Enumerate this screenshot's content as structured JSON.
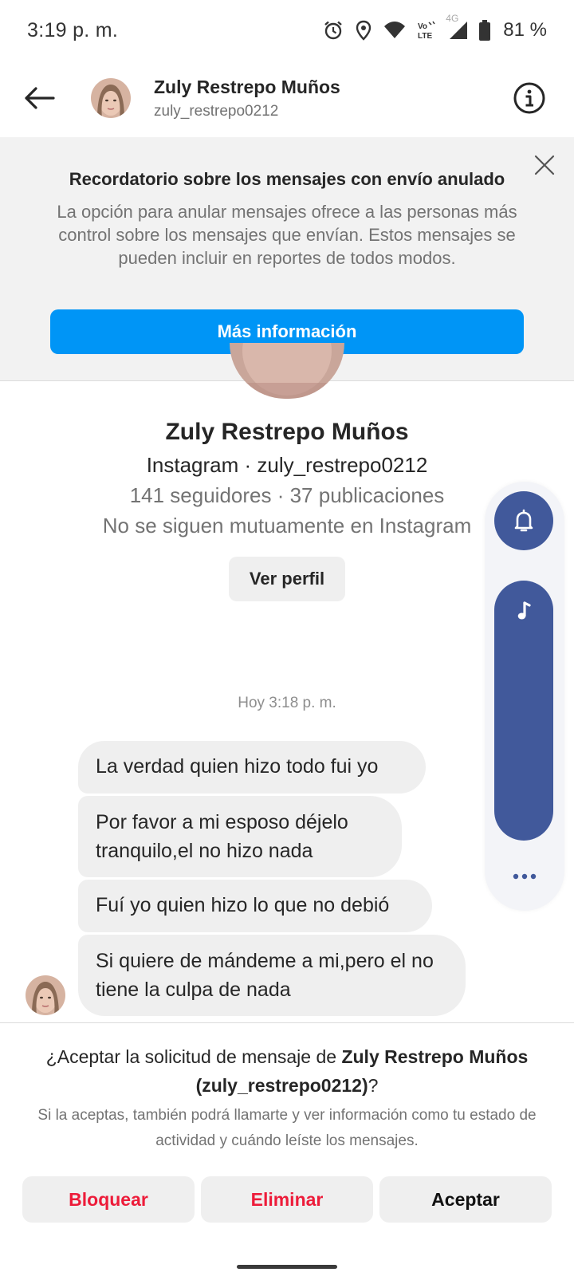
{
  "status_bar": {
    "time": "3:19 p. m.",
    "network_label": "4G",
    "battery": "81 %",
    "icons": [
      "alarm-icon",
      "location-icon",
      "wifi-icon",
      "volte-icon",
      "signal-icon",
      "battery-icon"
    ]
  },
  "header": {
    "name": "Zuly Restrepo Muños",
    "username": "zuly_restrepo0212"
  },
  "banner": {
    "title": "Recordatorio sobre los mensajes con envío anulado",
    "text": "La opción para anular mensajes ofrece a las personas más control sobre los mensajes que envían. Estos mensajes se pueden incluir en reportes de todos modos.",
    "button_label": "Más información"
  },
  "profile": {
    "name": "Zuly Restrepo Muños",
    "line1": "Instagram · zuly_restrepo0212",
    "line2": "141 seguidores · 37 publicaciones",
    "line3": "No se siguen mutuamente en Instagram",
    "button_label": "Ver perfil"
  },
  "conversation": {
    "timestamp": "Hoy 3:18 p. m.",
    "messages": [
      "La verdad quien hizo todo fui yo",
      "Por favor a mi esposo déjelo tranquilo,el no hizo nada",
      "Fuí yo quien hizo lo que no debió",
      "Si quiere de mándeme a mi,pero el no tiene la culpa de nada"
    ]
  },
  "request": {
    "title_prefix": "¿Aceptar la solicitud de mensaje de ",
    "title_name": "Zuly Restrepo Muños",
    "title_username": "(zuly_restrepo0212)",
    "title_suffix": "?",
    "description": "Si la aceptas, también podrá llamarte y ver información como tu estado de actividad y cuándo leíste los mensajes.",
    "buttons": {
      "block": "Bloquear",
      "delete": "Eliminar",
      "accept": "Aceptar"
    }
  },
  "colors": {
    "accent_blue": "#0095f6",
    "destructive_red": "#ed1c3a",
    "side_panel_blue": "#41599b"
  }
}
